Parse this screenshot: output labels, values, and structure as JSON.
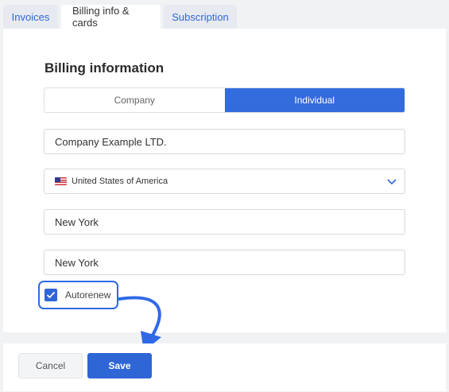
{
  "tabs": [
    {
      "label": "Invoices",
      "active": false
    },
    {
      "label": "Billing info & cards",
      "active": true
    },
    {
      "label": "Subscription",
      "active": false
    }
  ],
  "billing": {
    "title": "Billing information",
    "type_options": [
      "Company",
      "Individual"
    ],
    "selected_type": "Individual",
    "company_name": "Company Example LTD.",
    "country": "United States of America",
    "country_flag_icon": "us-flag-icon",
    "city": "New York",
    "region": "New York",
    "autorenew_label": "Autorenew",
    "autorenew_checked": true
  },
  "footer": {
    "cancel_label": "Cancel",
    "save_label": "Save"
  },
  "colors": {
    "accent": "#336cdc",
    "highlight": "#2f69e6"
  }
}
